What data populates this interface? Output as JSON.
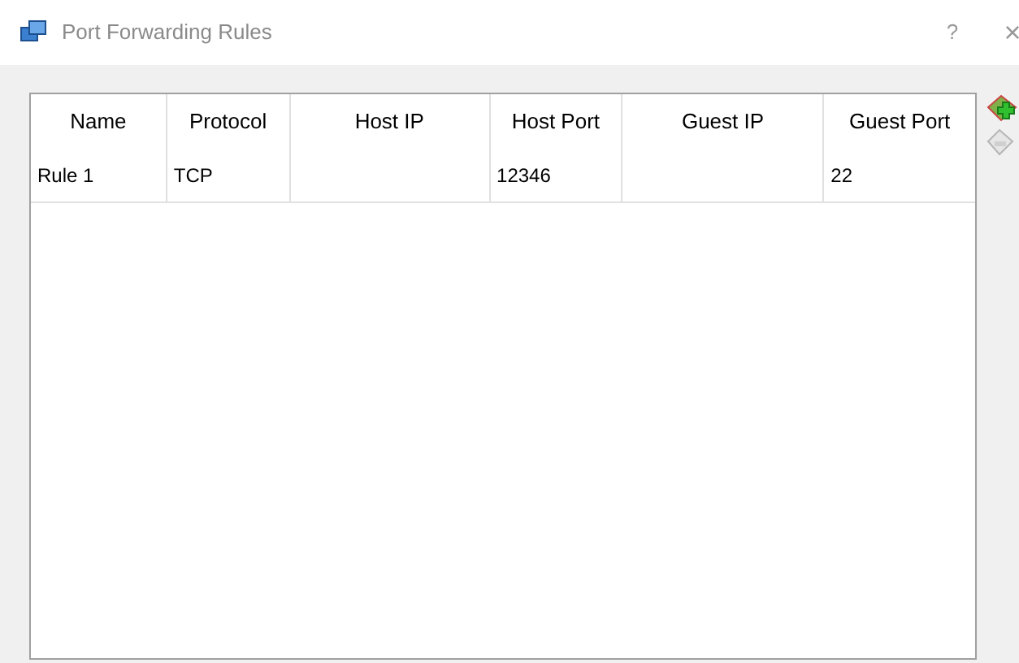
{
  "window": {
    "title": "Port Forwarding Rules",
    "help": "?",
    "close": "×"
  },
  "table": {
    "columns": [
      "Name",
      "Protocol",
      "Host IP",
      "Host Port",
      "Guest IP",
      "Guest Port"
    ],
    "rows": [
      {
        "name": "Rule 1",
        "protocol": "TCP",
        "host_port": "12346",
        "guest_port": "22"
      }
    ]
  },
  "side_buttons": [
    {
      "kind": "add",
      "disabled": false
    },
    {
      "kind": "remove",
      "disabled": true
    }
  ]
}
